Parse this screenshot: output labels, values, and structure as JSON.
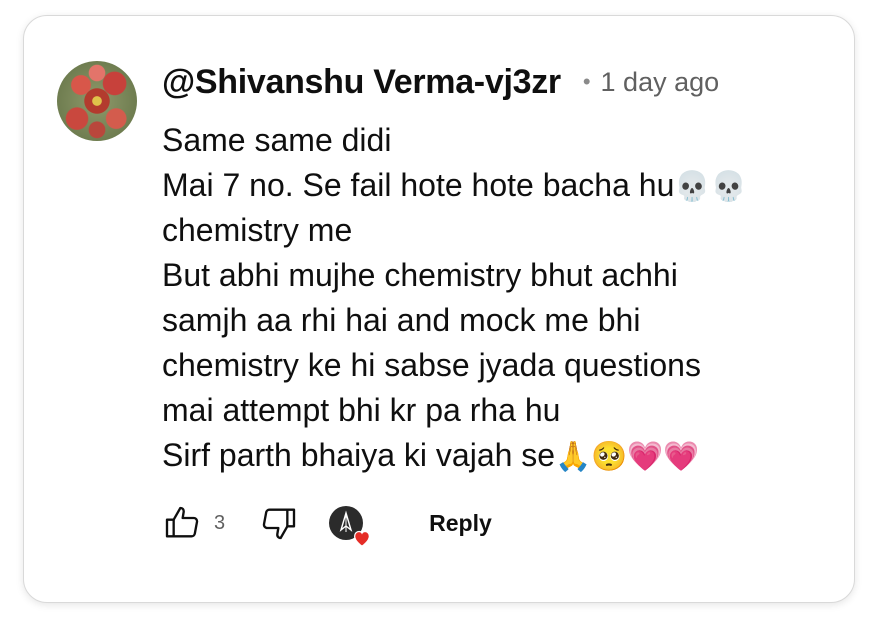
{
  "comment": {
    "author": "@Shivanshu Verma-vj3zr",
    "separator": "•",
    "timestamp": "1 day ago",
    "lines": [
      {
        "text": "Same same didi",
        "emoji": ""
      },
      {
        "text": "Mai 7 no. Se fail hote hote bacha hu",
        "emoji": "💀💀"
      },
      {
        "text": "chemistry me",
        "emoji": ""
      },
      {
        "text": "But abhi mujhe chemistry bhut achhi",
        "emoji": ""
      },
      {
        "text": "samjh aa rhi hai and mock me bhi",
        "emoji": ""
      },
      {
        "text": "chemistry ke hi sabse jyada questions",
        "emoji": ""
      },
      {
        "text": "mai attempt bhi kr pa rha hu",
        "emoji": ""
      },
      {
        "text": "Sirf parth bhaiya ki vajah se",
        "emoji": "🙏🥺💗💗"
      }
    ]
  },
  "actions": {
    "like_icon": "thumbs-up-icon",
    "like_count": "3",
    "dislike_icon": "thumbs-down-icon",
    "creator_heart_icon": "creator-heart-icon",
    "reply_label": "Reply"
  },
  "colors": {
    "text": "#0f0f0f",
    "secondary_text": "#606060",
    "heart": "#e52d27",
    "card_border": "#d9d9d9"
  }
}
